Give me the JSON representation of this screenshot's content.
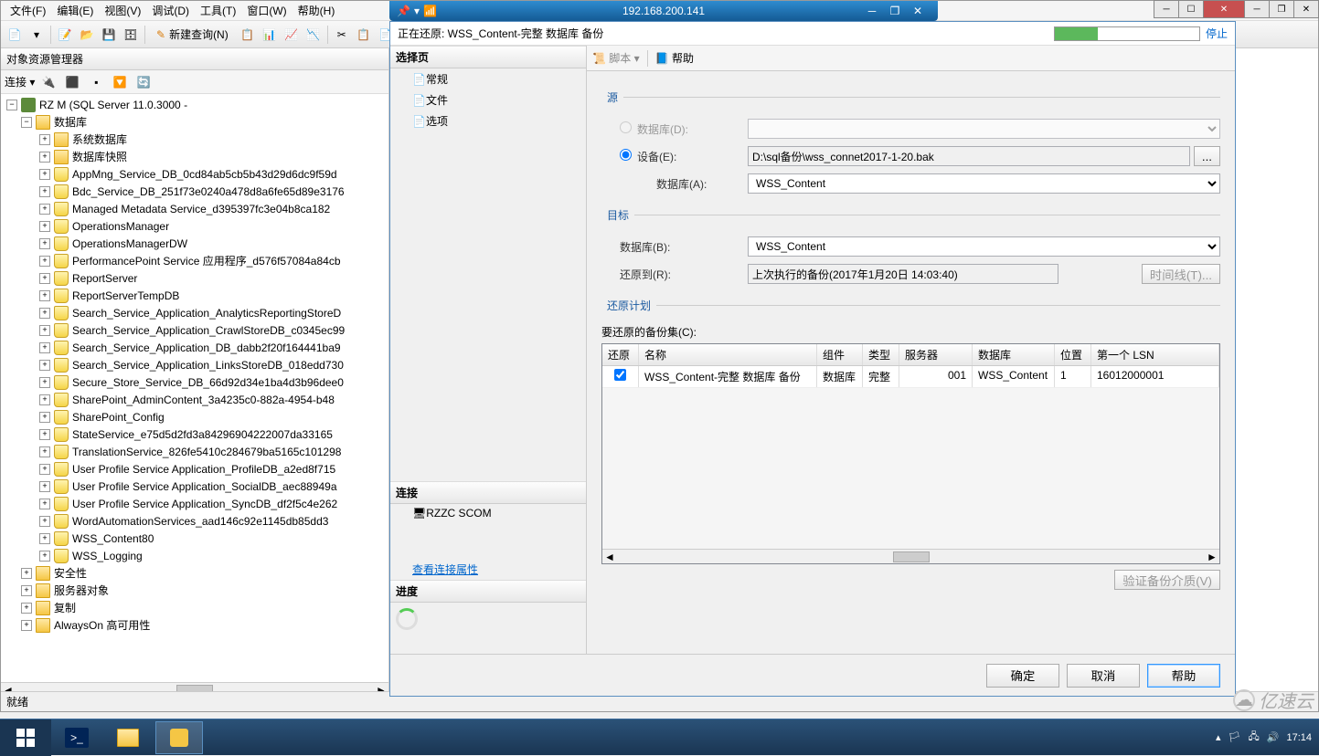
{
  "remote_ip": "192.168.200.141",
  "menubar": {
    "file": "文件(F)",
    "edit": "编辑(E)",
    "view": "视图(V)",
    "debug": "调试(D)",
    "tools": "工具(T)",
    "window": "窗口(W)",
    "help": "帮助(H)"
  },
  "toolbar": {
    "new_query": "新建查询(N)"
  },
  "object_explorer": {
    "title": "对象资源管理器",
    "connect_label": "连接",
    "server": "RZ                   M (SQL Server 11.0.3000 -",
    "db_folder": "数据库",
    "sys_db": "系统数据库",
    "db_snapshot": "数据库快照",
    "databases": [
      "AppMng_Service_DB_0cd84ab5cb5b43d29d6dc9f59d",
      "Bdc_Service_DB_251f73e0240a478d8a6fe65d89e3176",
      "Managed Metadata Service_d395397fc3e04b8ca182",
      "OperationsManager",
      "OperationsManagerDW",
      "PerformancePoint Service 应用程序_d576f57084a84cb",
      "ReportServer",
      "ReportServerTempDB",
      "Search_Service_Application_AnalyticsReportingStoreD",
      "Search_Service_Application_CrawlStoreDB_c0345ec99",
      "Search_Service_Application_DB_dabb2f20f164441ba9",
      "Search_Service_Application_LinksStoreDB_018edd730",
      "Secure_Store_Service_DB_66d92d34e1ba4d3b96dee0",
      "SharePoint_AdminContent_3a4235c0-882a-4954-b48",
      "SharePoint_Config",
      "StateService_e75d5d2fd3a84296904222007da33165",
      "TranslationService_826fe5410c284679ba5165c101298",
      "User Profile Service Application_ProfileDB_a2ed8f715",
      "User Profile Service Application_SocialDB_aec88949a",
      "User Profile Service Application_SyncDB_df2f5c4e262",
      "WordAutomationServices_aad146c92e1145db85dd3",
      "WSS_Content80",
      "WSS_Logging"
    ],
    "security": "安全性",
    "server_objects": "服务器对象",
    "replication": "复制",
    "alwayson": "AlwaysOn 高可用性"
  },
  "dialog": {
    "title": "正在还原: WSS_Content-完整 数据库 备份",
    "stop": "停止",
    "left": {
      "select_page": "选择页",
      "general": "常规",
      "files": "文件",
      "options": "选项",
      "connection": "连接",
      "server_conn": "RZZC            SCOM",
      "view_conn": "查看连接属性",
      "progress": "进度"
    },
    "toolbar": {
      "script": "脚本",
      "help": "帮助"
    },
    "source": {
      "legend": "源",
      "database_radio": "数据库(D):",
      "device_radio": "设备(E):",
      "device_path": "D:\\sql备份\\wss_connet2017-1-20.bak",
      "browse": "...",
      "database_a": "数据库(A):",
      "database_a_val": "WSS_Content"
    },
    "target": {
      "legend": "目标",
      "database_b": "数据库(B):",
      "database_b_val": "WSS_Content",
      "restore_to": "还原到(R):",
      "restore_to_val": "上次执行的备份(2017年1月20日 14:03:40)",
      "timeline": "时间线(T)..."
    },
    "plan": {
      "legend": "还原计划",
      "backup_set": "要还原的备份集(C):",
      "headers": {
        "restore": "还原",
        "name": "名称",
        "component": "组件",
        "type": "类型",
        "server": "服务器",
        "database": "数据库",
        "position": "位置",
        "first_lsn": "第一个 LSN"
      },
      "row": {
        "name": "WSS_Content-完整 数据库 备份",
        "component": "数据库",
        "type": "完整",
        "server": "001",
        "database": "WSS_Content",
        "position": "1",
        "first_lsn": "16012000001"
      },
      "verify": "验证备份介质(V)"
    },
    "footer": {
      "ok": "确定",
      "cancel": "取消",
      "help": "帮助"
    }
  },
  "status_bar": "就绪",
  "watermark": "亿速云",
  "tray_time": "17:14"
}
